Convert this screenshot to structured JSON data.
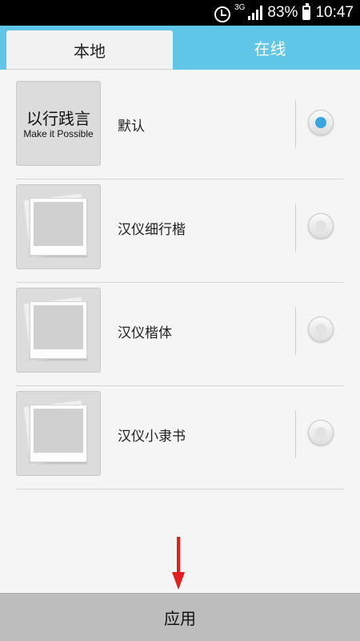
{
  "status_bar": {
    "network": "3G",
    "battery": "83%",
    "time": "10:47",
    "icons": [
      "alarm-icon",
      "signal-icon",
      "battery-icon"
    ]
  },
  "tabs": [
    {
      "label": "本地",
      "active": true
    },
    {
      "label": "在线",
      "active": false
    }
  ],
  "fonts": [
    {
      "name": "默认",
      "preview_title": "以行践言",
      "preview_subtitle": "Make it Possible",
      "selected": true
    },
    {
      "name": "汉仪细行楷",
      "selected": false,
      "preview_icon": "image-placeholder-icon"
    },
    {
      "name": "汉仪楷体",
      "selected": false,
      "preview_icon": "image-placeholder-icon"
    },
    {
      "name": "汉仪小隶书",
      "selected": false,
      "preview_icon": "image-placeholder-icon"
    }
  ],
  "apply_button": {
    "label": "应用"
  },
  "colors": {
    "accent": "#5fc6e8",
    "radio_selected": "#3aa6e0",
    "annotation_arrow": "#e31e1e"
  }
}
